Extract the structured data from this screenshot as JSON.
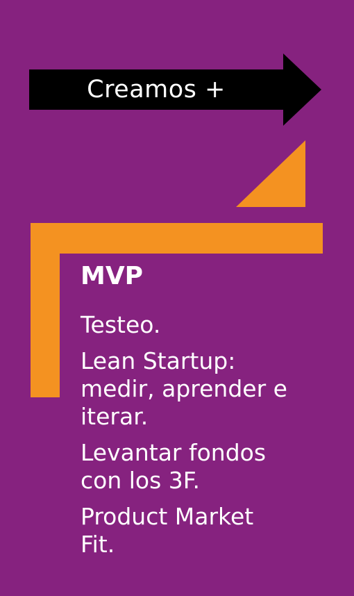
{
  "colors": {
    "background": "#86227f",
    "arrow": "#000000",
    "accent_orange": "#f49221",
    "text": "#ffffff"
  },
  "banner": {
    "label": "Creamos +"
  },
  "section": {
    "heading": "MVP",
    "items": [
      "Testeo.",
      "Lean Startup:\nmedir, aprender e\niterar.",
      "Levantar fondos\ncon los 3F.",
      "Product Market\nFit."
    ]
  }
}
